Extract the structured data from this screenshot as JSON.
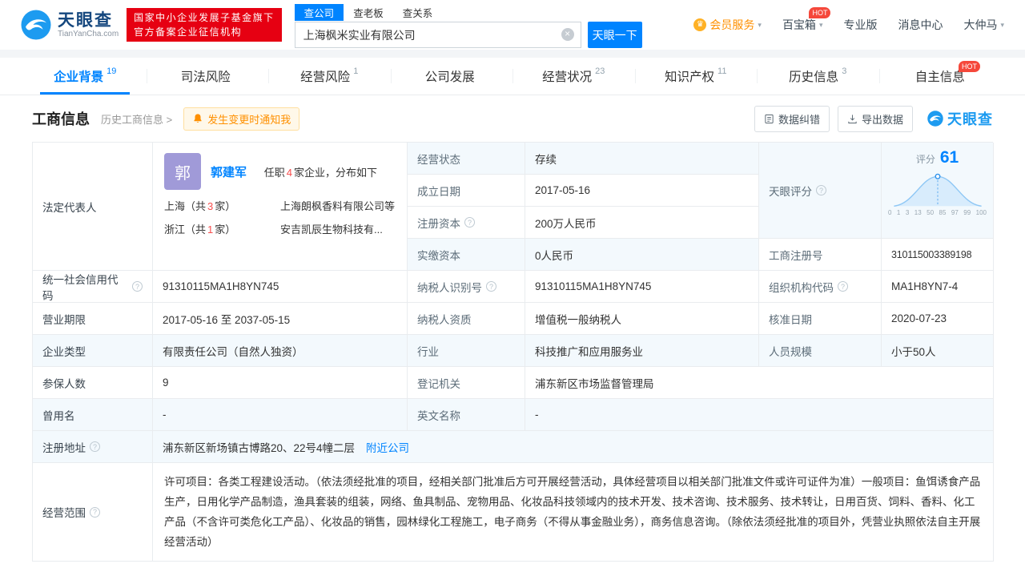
{
  "brand": {
    "name": "天眼查",
    "domain": "TianYanCha.com",
    "badge_line1": "国家中小企业发展子基金旗下",
    "badge_line2": "官方备案企业征信机构",
    "accent_blue": "#0084ff",
    "accent_red": "#e60012"
  },
  "search": {
    "tabs": [
      "查公司",
      "查老板",
      "查关系"
    ],
    "value": "上海枫米实业有限公司",
    "button_label": "天眼一下"
  },
  "top_menu": {
    "vip": "会员服务",
    "toolbox": "百宝箱",
    "hot_badge": "HOT",
    "pro": "专业版",
    "messages": "消息中心",
    "user": "大仲马"
  },
  "nav_tabs": [
    {
      "label": "企业背景",
      "count": "19"
    },
    {
      "label": "司法风险",
      "count": ""
    },
    {
      "label": "经营风险",
      "count": "1"
    },
    {
      "label": "公司发展",
      "count": ""
    },
    {
      "label": "经营状况",
      "count": "23"
    },
    {
      "label": "知识产权",
      "count": "11"
    },
    {
      "label": "历史信息",
      "count": "3"
    },
    {
      "label": "自主信息",
      "count": "",
      "badge": "HOT"
    }
  ],
  "section": {
    "title": "工商信息",
    "history_link": "历史工商信息 >",
    "notify_label": "发生变更时通知我",
    "correction_btn": "数据纠错",
    "export_btn": "导出数据",
    "watermark": "天眼查"
  },
  "legal": {
    "label": "法定代表人",
    "avatar": "郭",
    "name": "郭建军",
    "tenure_prefix": "任职",
    "tenure_count": "4",
    "tenure_suffix": "家企业，分布如下",
    "regions": [
      {
        "area": "上海",
        "pre": "（共",
        "num": "3",
        "post": "家）",
        "company": "上海朗枫香料有限公司等"
      },
      {
        "area": "浙江",
        "pre": "（共",
        "num": "1",
        "post": "家）",
        "company": "安吉凯辰生物科技有..."
      }
    ]
  },
  "score": {
    "k": "天眼评分",
    "prefix": "评分",
    "value": "61",
    "axis": [
      "0",
      "1",
      "3",
      "13",
      "50",
      "85",
      "97",
      "99",
      "100"
    ]
  },
  "fields": {
    "status": {
      "k": "经营状态",
      "v": "存续"
    },
    "established": {
      "k": "成立日期",
      "v": "2017-05-16"
    },
    "reg_capital": {
      "k": "注册资本",
      "v": "200万人民币"
    },
    "paid_capital": {
      "k": "实缴资本",
      "v": "0人民币"
    },
    "reg_no": {
      "k": "工商注册号",
      "v": "310115003389198"
    },
    "credit_code": {
      "k": "统一社会信用代码",
      "v": "91310115MA1H8YN745"
    },
    "tax_id": {
      "k": "纳税人识别号",
      "v": "91310115MA1H8YN745"
    },
    "org_code": {
      "k": "组织机构代码",
      "v": "MA1H8YN7-4"
    },
    "term": {
      "k": "营业期限",
      "v": "2017-05-16 至 2037-05-15"
    },
    "tax_quality": {
      "k": "纳税人资质",
      "v": "增值税一般纳税人"
    },
    "approved": {
      "k": "核准日期",
      "v": "2020-07-23"
    },
    "company_type": {
      "k": "企业类型",
      "v": "有限责任公司（自然人独资）"
    },
    "industry": {
      "k": "行业",
      "v": "科技推广和应用服务业"
    },
    "staff_size": {
      "k": "人员规模",
      "v": "小于50人"
    },
    "insured": {
      "k": "参保人数",
      "v": "9"
    },
    "registry": {
      "k": "登记机关",
      "v": "浦东新区市场监督管理局"
    },
    "former_name": {
      "k": "曾用名",
      "v": "-"
    },
    "english_name": {
      "k": "英文名称",
      "v": "-"
    },
    "address": {
      "k": "注册地址",
      "v": "浦东新区新场镇古博路20、22号4幢二层",
      "link": "附近公司"
    },
    "scope": {
      "k": "经营范围",
      "v": "许可项目：各类工程建设活动。（依法须经批准的项目，经相关部门批准后方可开展经营活动，具体经营项目以相关部门批准文件或许可证件为准）一般项目：鱼饵诱食产品生产，日用化学产品制造，渔具套装的组装，网络、鱼具制品、宠物用品、化妆品科技领域内的技术开发、技术咨询、技术服务、技术转让，日用百货、饲料、香料、化工产品（不含许可类危化工产品）、化妆品的销售，园林绿化工程施工，电子商务（不得从事金融业务），商务信息咨询。（除依法须经批准的项目外，凭营业执照依法自主开展经营活动）"
    }
  }
}
